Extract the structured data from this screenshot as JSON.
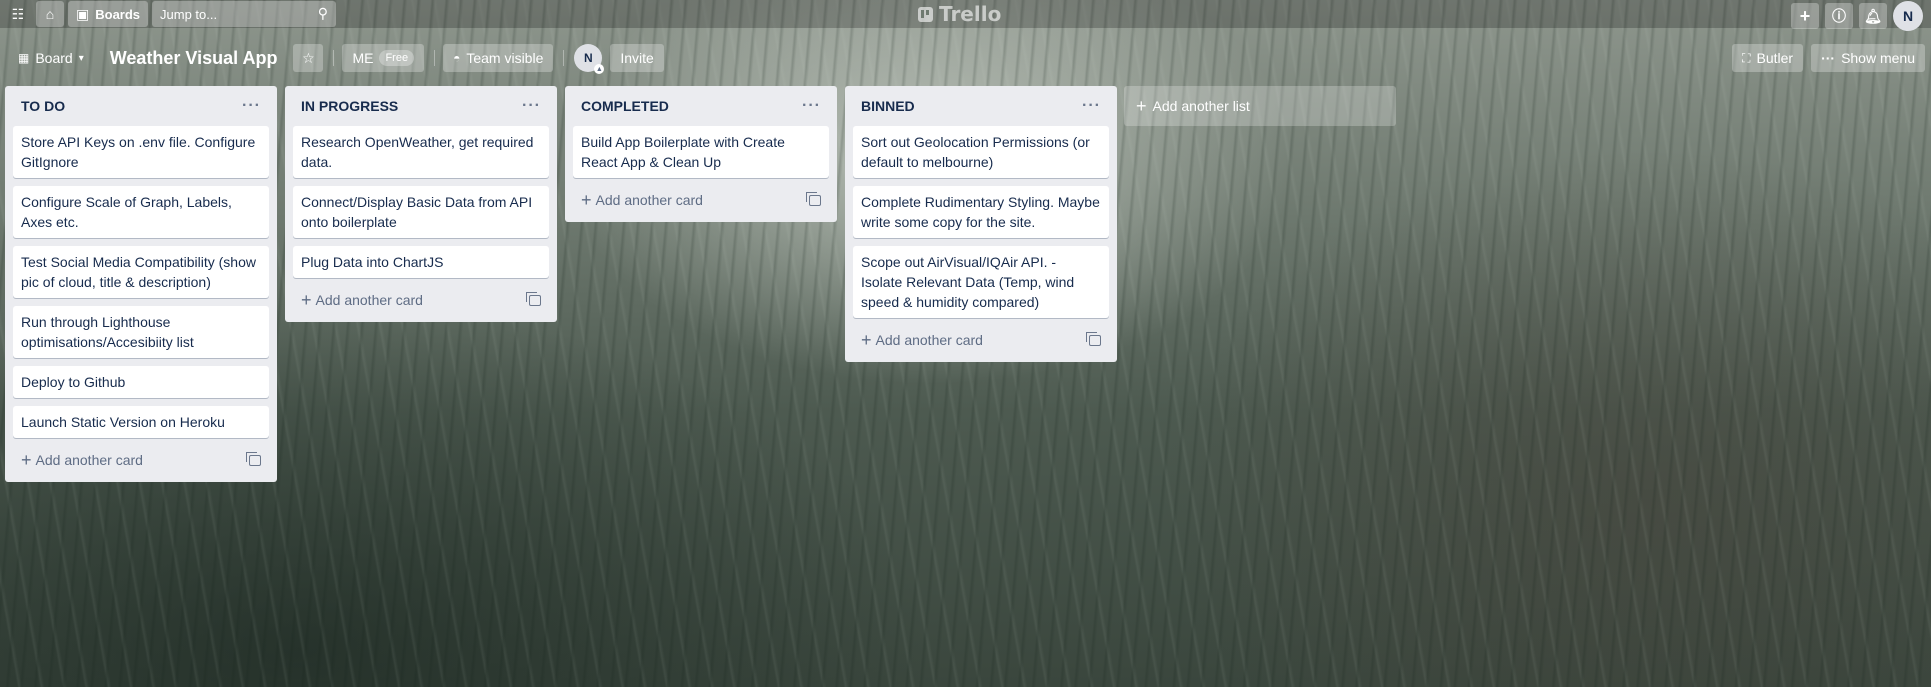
{
  "header": {
    "boards_label": "Boards",
    "search_placeholder": "Jump to...",
    "logo_text": "Trello",
    "user_initial": "N"
  },
  "board": {
    "view_label": "Board",
    "title": "Weather Visual App",
    "workspace_label": "ME",
    "plan_badge": "Free",
    "visibility_label": "Team visible",
    "member_initial": "N",
    "invite_label": "Invite",
    "butler_label": "Butler",
    "show_menu_label": "Show menu"
  },
  "add_card_label": "Add another card",
  "add_list_label": "Add another list",
  "lists": [
    {
      "title": "TO DO",
      "cards": [
        "Store API Keys on .env file. Configure GitIgnore",
        "Configure Scale of Graph, Labels, Axes etc.",
        "Test Social Media Compatibility (show pic of cloud, title & description)",
        "Run through Lighthouse optimisations/Accesibiity list",
        "Deploy to Github",
        "Launch Static Version on Heroku"
      ]
    },
    {
      "title": "IN PROGRESS",
      "cards": [
        "Research OpenWeather, get required data.",
        "Connect/Display Basic Data from API onto boilerplate",
        "Plug Data into ChartJS"
      ]
    },
    {
      "title": "COMPLETED",
      "cards": [
        "Build App Boilerplate with Create React App & Clean Up"
      ]
    },
    {
      "title": "BINNED",
      "cards": [
        "Sort out Geolocation Permissions (or default to melbourne)",
        "Complete Rudimentary Styling. Maybe write some copy for the site.",
        "Scope out AirVisual/IQAir API. - Isolate Relevant Data (Temp, wind speed & humidity compared)"
      ]
    }
  ]
}
